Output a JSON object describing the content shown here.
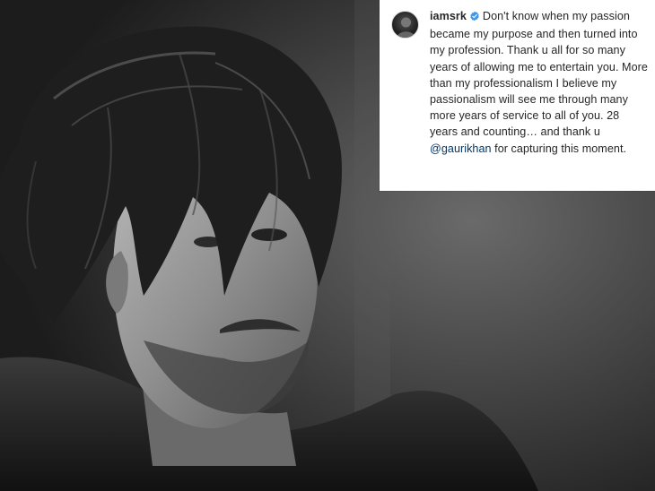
{
  "post": {
    "username": "iamsrk",
    "verified": true,
    "caption_before_mention": "Don't know when my passion became my purpose and then turned into my profession. Thank u all for so many years of allowing me to entertain you. More than my professionalism I believe my passionalism will see me through many more years of service to all of you. 28 years and counting… and thank u ",
    "mention": "@gaurikhan",
    "caption_after_mention": " for capturing this moment."
  },
  "colors": {
    "verified_badge": "#3897f0",
    "mention_link": "#00376b",
    "text": "#262626"
  },
  "icons": {
    "verified": "verified-badge-icon",
    "avatar": "profile-avatar"
  }
}
